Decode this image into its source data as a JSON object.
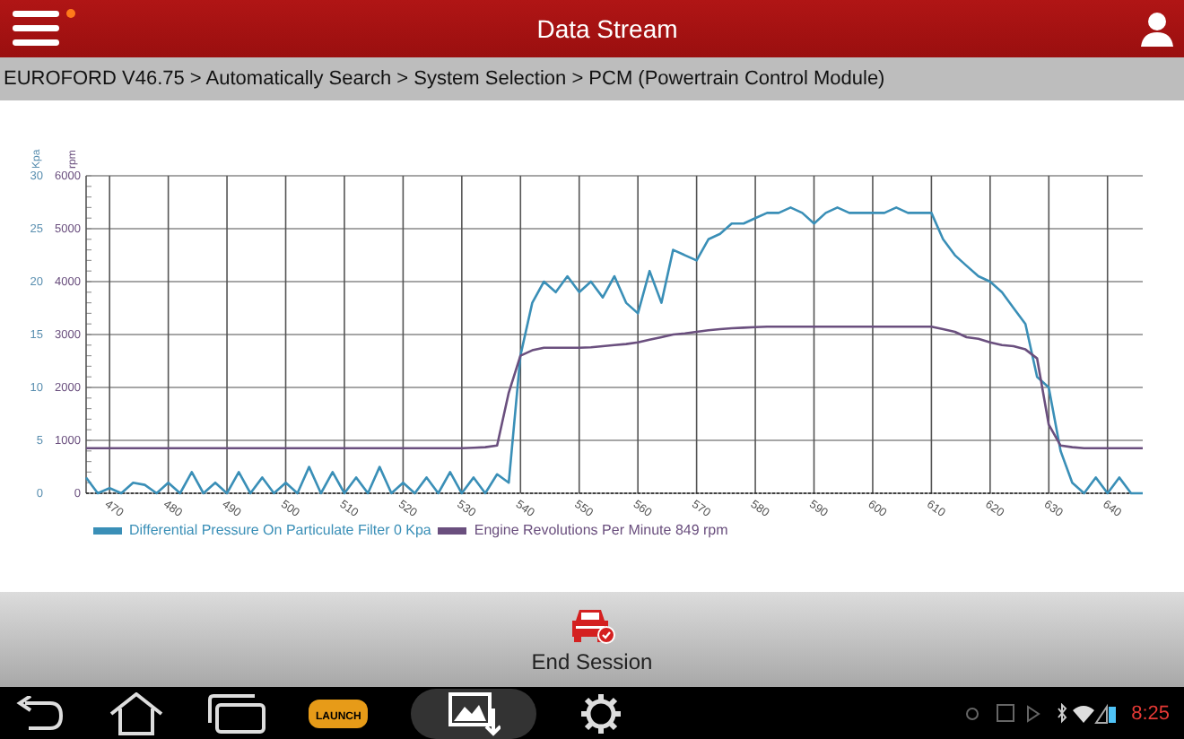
{
  "header": {
    "title": "Data Stream",
    "notification_dot": true
  },
  "breadcrumb": "EUROFORD V46.75 > Automatically Search > System Selection > PCM (Powertrain Control Module)",
  "chart": {
    "chart_data": {
      "type": "line",
      "grid": true,
      "ylabel": "Kpa",
      "y2label": "rpm",
      "xlim": [
        466,
        646
      ],
      "ylim": [
        0,
        30
      ],
      "y2lim": [
        0,
        6000
      ],
      "xticks": [
        470,
        480,
        490,
        500,
        510,
        520,
        530,
        540,
        550,
        560,
        570,
        580,
        590,
        600,
        610,
        620,
        630,
        640
      ],
      "yticks": [
        0,
        5,
        10,
        15,
        20,
        25,
        30
      ],
      "y2ticks": [
        0,
        1000,
        2000,
        3000,
        4000,
        5000,
        6000
      ],
      "x": [
        466,
        468,
        470,
        472,
        474,
        476,
        478,
        480,
        482,
        484,
        486,
        488,
        490,
        492,
        494,
        496,
        498,
        500,
        502,
        504,
        506,
        508,
        510,
        512,
        514,
        516,
        518,
        520,
        522,
        524,
        526,
        528,
        530,
        532,
        534,
        536,
        538,
        540,
        542,
        544,
        546,
        548,
        550,
        552,
        554,
        556,
        558,
        560,
        562,
        564,
        566,
        568,
        570,
        572,
        574,
        576,
        578,
        580,
        582,
        584,
        586,
        588,
        590,
        592,
        594,
        596,
        598,
        600,
        602,
        604,
        606,
        608,
        610,
        612,
        614,
        616,
        618,
        620,
        622,
        624,
        626,
        628,
        630,
        632,
        634,
        636,
        638,
        640,
        642,
        644,
        646
      ],
      "series": [
        {
          "name": "Differential Pressure On Particulate Filter 0 Kpa",
          "color": "#3a8fb7",
          "values": [
            1.5,
            0,
            0.5,
            0,
            1,
            0.8,
            0,
            1,
            0,
            2,
            0,
            1,
            0,
            2,
            0,
            1.5,
            0,
            1,
            0,
            2.5,
            0,
            2,
            0,
            1.5,
            0,
            2.5,
            0,
            1,
            0,
            1.5,
            0,
            2,
            0,
            1.5,
            0,
            1.8,
            1,
            13,
            18,
            20,
            19,
            20.5,
            19,
            20,
            18.5,
            20.5,
            18,
            17,
            21,
            18,
            23,
            22.5,
            22,
            24,
            24.5,
            25.5,
            25.5,
            26,
            26.5,
            26.5,
            27,
            26.5,
            25.5,
            26.5,
            27,
            26.5,
            26.5,
            26.5,
            26.5,
            27,
            26.5,
            26.5,
            26.5,
            24,
            22.5,
            21.5,
            20.5,
            20,
            19,
            17.5,
            16,
            11,
            10,
            4,
            1,
            0,
            1.5,
            0,
            1.5,
            0,
            0
          ]
        },
        {
          "name": "Engine Revolutions Per Minute 849 rpm",
          "color": "#6a4f7e",
          "axis": "y2",
          "values": [
            850,
            850,
            850,
            850,
            850,
            850,
            850,
            850,
            850,
            850,
            850,
            850,
            850,
            850,
            850,
            850,
            850,
            850,
            850,
            850,
            850,
            850,
            850,
            850,
            850,
            850,
            850,
            850,
            850,
            850,
            850,
            850,
            850,
            860,
            870,
            900,
            1900,
            2600,
            2700,
            2750,
            2750,
            2750,
            2750,
            2760,
            2780,
            2800,
            2820,
            2850,
            2900,
            2950,
            3000,
            3020,
            3050,
            3080,
            3100,
            3120,
            3130,
            3140,
            3150,
            3150,
            3150,
            3150,
            3150,
            3150,
            3150,
            3150,
            3150,
            3150,
            3150,
            3150,
            3150,
            3150,
            3150,
            3100,
            3050,
            2950,
            2920,
            2850,
            2800,
            2780,
            2720,
            2550,
            1300,
            900,
            870,
            850,
            850,
            850,
            850,
            850,
            850
          ]
        }
      ]
    }
  },
  "action": {
    "label": "End Session"
  },
  "navbar": {
    "logo_text": "LAUNCH",
    "time": "8:25"
  }
}
